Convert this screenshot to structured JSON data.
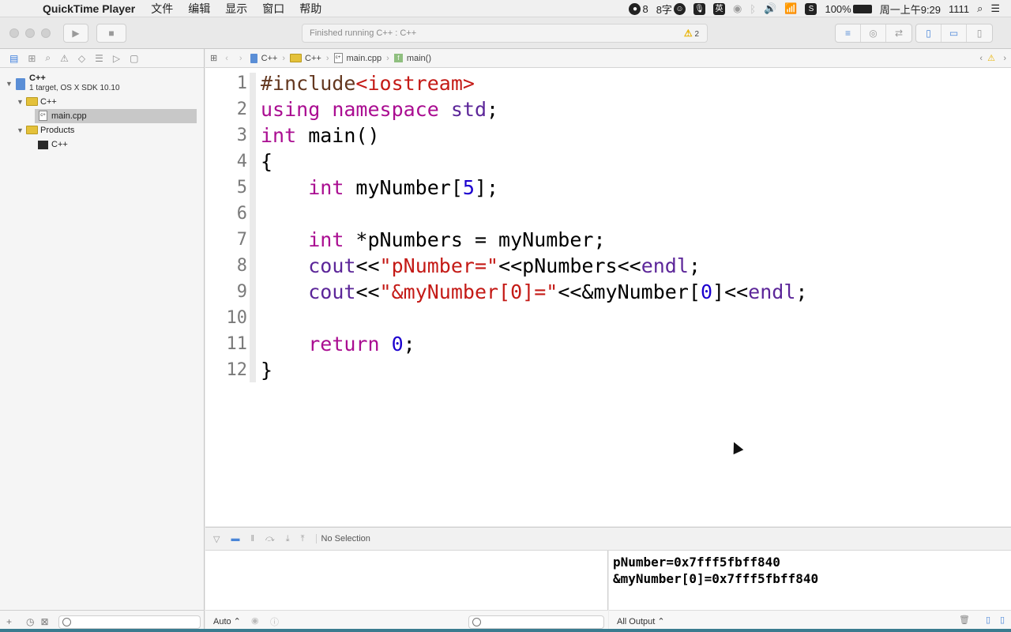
{
  "menubar": {
    "app_name": "QuickTime Player",
    "menus": [
      "文件",
      "编辑",
      "显示",
      "窗口",
      "帮助"
    ],
    "status": {
      "notif_count": "8",
      "ime_count": "8字",
      "ime_lang": "英",
      "battery": "100%",
      "datetime": "周一上午9:29",
      "user": "1111"
    }
  },
  "toolbar": {
    "activity_text": "Finished running C++ : C++",
    "warning_count": "2"
  },
  "navigator": {
    "project_name": "C++",
    "project_sub": "1 target, OS X SDK 10.10",
    "group_name": "C++",
    "file_name": "main.cpp",
    "products_name": "Products",
    "product_item": "C++"
  },
  "jumpbar": {
    "crumbs": [
      "C++",
      "C++",
      "main.cpp",
      "main()"
    ]
  },
  "editor": {
    "line_numbers": [
      "1",
      "2",
      "3",
      "4",
      "5",
      "6",
      "7",
      "8",
      "9",
      "10",
      "11",
      "12"
    ]
  },
  "debug": {
    "no_selection": "No Selection",
    "var_scope": "Auto ⌃",
    "output_scope": "All Output ⌃",
    "console_output": "pNumber=0x7fff5fbff840\n&myNumber[0]=0x7fff5fbff840"
  },
  "colors": {
    "keyword": "#aa0d91",
    "string": "#c41a16",
    "number": "#1c00cf",
    "library": "#5c2699",
    "preprocessor": "#643820"
  }
}
